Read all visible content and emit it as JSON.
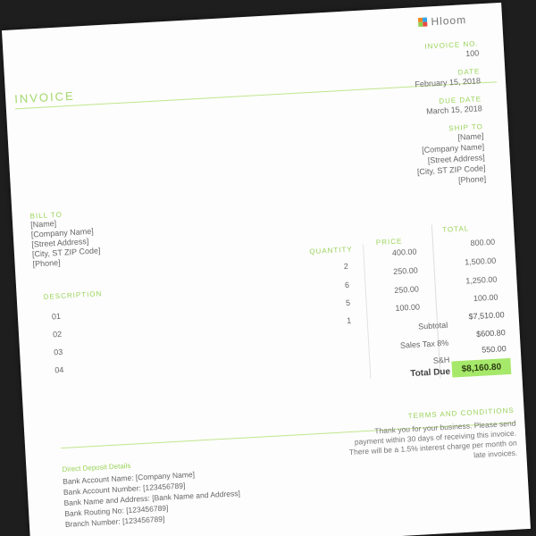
{
  "brand": {
    "name": "Hloom",
    "colors": [
      "#f08a24",
      "#2fa4e7",
      "#8fd14f",
      "#e84c3d"
    ]
  },
  "title": "INVOICE",
  "meta": {
    "invoice_no_label": "INVOICE NO.",
    "invoice_no": "100",
    "date_label": "DATE",
    "date": "February 15, 2018",
    "due_label": "DUE DATE",
    "due": "March 15, 2018",
    "ship_label": "SHIP TO",
    "ship_lines": [
      "[Name]",
      "[Company Name]",
      "[Street Address]",
      "[City, ST ZIP Code]",
      "[Phone]"
    ]
  },
  "bill_to": {
    "label": "BILL TO",
    "lines": [
      "[Name]",
      "[Company Name]",
      "[Street Address]",
      "[City, ST ZIP Code]",
      "[Phone]"
    ]
  },
  "table": {
    "headers": {
      "description": "DESCRIPTION",
      "quantity": "QUANTITY",
      "price": "PRICE",
      "total": "TOTAL"
    },
    "rows": [
      {
        "no": "01",
        "qty": "2",
        "price": "400.00",
        "total": "800.00"
      },
      {
        "no": "02",
        "qty": "6",
        "price": "250.00",
        "total": "1,500.00"
      },
      {
        "no": "03",
        "qty": "5",
        "price": "250.00",
        "total": "1,250.00"
      },
      {
        "no": "04",
        "qty": "1",
        "price": "100.00",
        "total": "100.00"
      }
    ]
  },
  "summary": {
    "subtotal_label": "Subtotal",
    "subtotal": "$7,510.00",
    "tax_label": "Sales Tax 8%",
    "tax": "$600.80",
    "shipping_label": "S&H",
    "shipping": "550.00",
    "total_label": "Total Due",
    "total": "$8,160.80"
  },
  "bank": {
    "title": "Direct Deposit Details",
    "lines": [
      "Bank Account Name: [Company Name]",
      "Bank Account Number: [123456789]",
      "Bank Name and Address: [Bank Name and Address]",
      "Bank Routing No: [123456789]",
      "Branch Number: [123456789]"
    ]
  },
  "terms": {
    "title": "TERMS AND CONDITIONS",
    "text": "Thank you for your business. Please send payment within 30 days of receiving this invoice. There will be a 1.5% interest charge per month on late invoices."
  }
}
